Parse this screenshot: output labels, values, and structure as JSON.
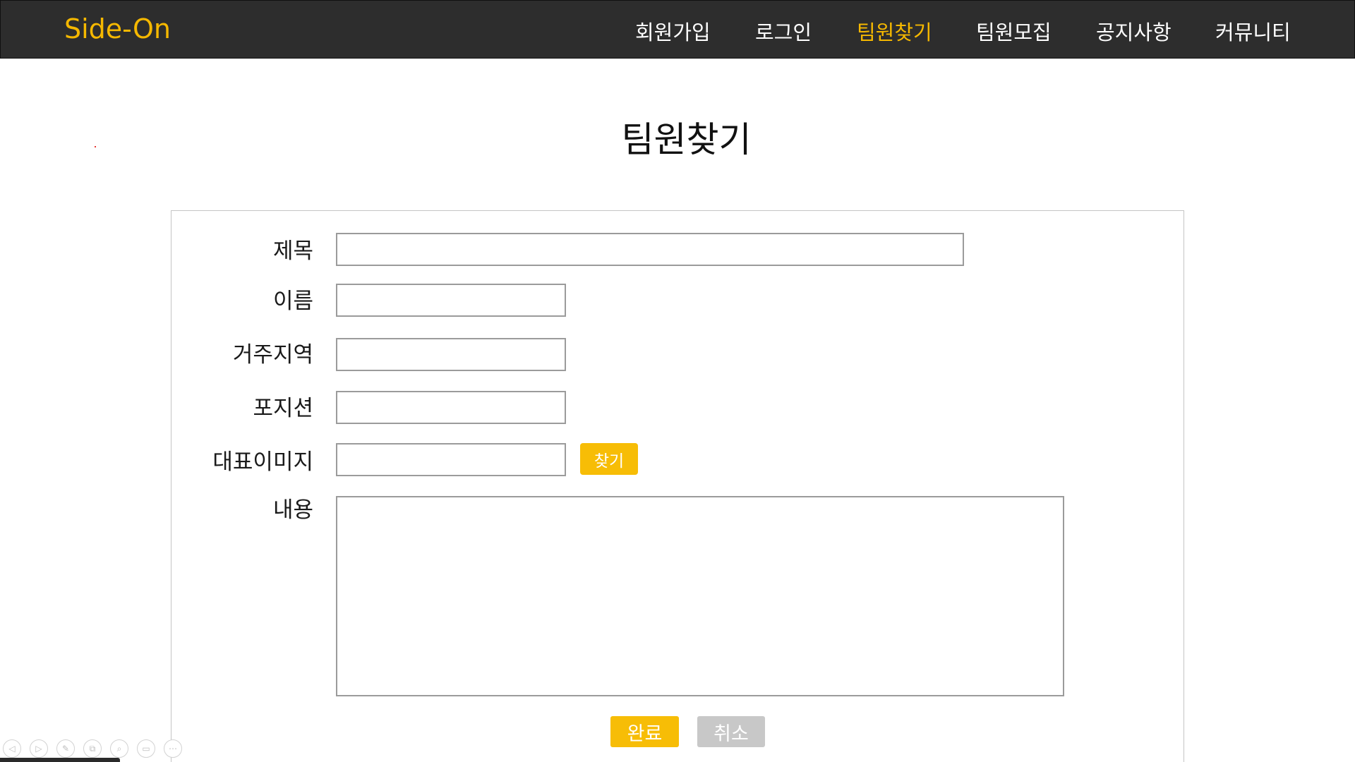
{
  "header": {
    "brand": "Side-On",
    "nav": [
      {
        "label": "회원가입"
      },
      {
        "label": "로그인"
      },
      {
        "label": "팀원찾기",
        "active": true
      },
      {
        "label": "팀원모집"
      },
      {
        "label": "공지사항"
      },
      {
        "label": "커뮤니티"
      }
    ]
  },
  "page": {
    "title": "팀원찾기"
  },
  "form": {
    "title_label": "제목",
    "title_value": "",
    "name_label": "이름",
    "name_value": "",
    "region_label": "거주지역",
    "region_value": "",
    "position_label": "포지션",
    "position_value": "",
    "image_label": "대표이미지",
    "image_value": "",
    "find_button": "찾기",
    "content_label": "내용",
    "content_value": "",
    "submit_button": "완료",
    "cancel_button": "취소"
  },
  "viewer_toolbar": {
    "icons": [
      "prev-icon",
      "next-icon",
      "pen-icon",
      "pages-icon",
      "zoom-icon",
      "subtitle-icon",
      "more-icon"
    ],
    "glyphs": [
      "◁",
      "▷",
      "✎",
      "⧉",
      "⌕",
      "▭",
      "⋯"
    ]
  },
  "colors": {
    "navbar_bg": "#2d2d2d",
    "accent": "#f7bd06",
    "cancel": "#c8c8c8",
    "input_border": "#9b9b9b"
  }
}
